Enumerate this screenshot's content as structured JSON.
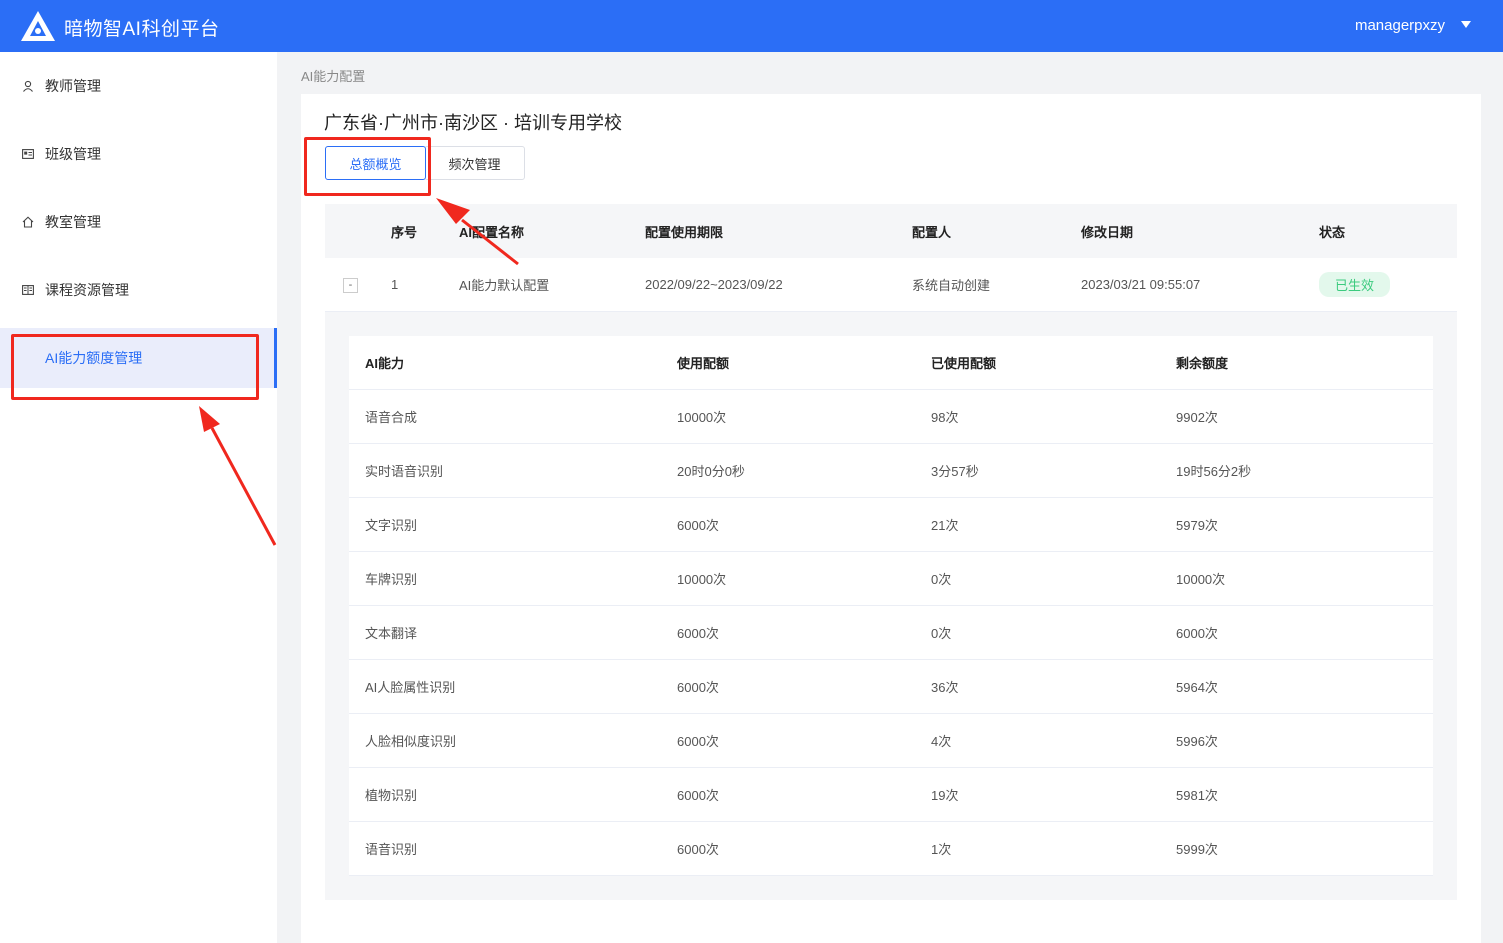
{
  "header": {
    "app_title": "暗物智AI科创平台",
    "username": "managerpxzy",
    "brand_color": "#2b6ef6"
  },
  "sidebar": {
    "items": [
      {
        "label": "教师管理",
        "icon": "user-icon"
      },
      {
        "label": "班级管理",
        "icon": "id-card-icon"
      },
      {
        "label": "教室管理",
        "icon": "home-icon"
      },
      {
        "label": "课程资源管理",
        "icon": "book-icon"
      },
      {
        "label": "AI能力额度管理",
        "icon": "",
        "active": true
      }
    ]
  },
  "breadcrumb": "AI能力配置",
  "school_title": "广东省·广州市·南沙区 · 培训专用学校",
  "tabs": {
    "overview": "总额概览",
    "frequency": "频次管理"
  },
  "config_table": {
    "headers": {
      "index": "序号",
      "name": "AI配置名称",
      "period": "配置使用期限",
      "creator": "配置人",
      "modified": "修改日期",
      "status": "状态"
    },
    "rows": [
      {
        "expand": "-",
        "index": "1",
        "name": "AI能力默认配置",
        "period": "2022/09/22~2023/09/22",
        "creator": "系统自动创建",
        "modified": "2023/03/21 09:55:07",
        "status": "已生效"
      }
    ]
  },
  "quota_table": {
    "headers": {
      "ability": "AI能力",
      "quota": "使用配额",
      "used": "已使用配额",
      "remaining": "剩余额度"
    },
    "rows": [
      {
        "ability": "语音合成",
        "quota": "10000次",
        "used": "98次",
        "remaining": "9902次"
      },
      {
        "ability": "实时语音识别",
        "quota": "20时0分0秒",
        "used": "3分57秒",
        "remaining": "19时56分2秒"
      },
      {
        "ability": "文字识别",
        "quota": "6000次",
        "used": "21次",
        "remaining": "5979次"
      },
      {
        "ability": "车牌识别",
        "quota": "10000次",
        "used": "0次",
        "remaining": "10000次"
      },
      {
        "ability": "文本翻译",
        "quota": "6000次",
        "used": "0次",
        "remaining": "6000次"
      },
      {
        "ability": "AI人脸属性识别",
        "quota": "6000次",
        "used": "36次",
        "remaining": "5964次"
      },
      {
        "ability": "人脸相似度识别",
        "quota": "6000次",
        "used": "4次",
        "remaining": "5996次"
      },
      {
        "ability": "植物识别",
        "quota": "6000次",
        "used": "19次",
        "remaining": "5981次"
      },
      {
        "ability": "语音识别",
        "quota": "6000次",
        "used": "1次",
        "remaining": "5999次"
      }
    ]
  }
}
